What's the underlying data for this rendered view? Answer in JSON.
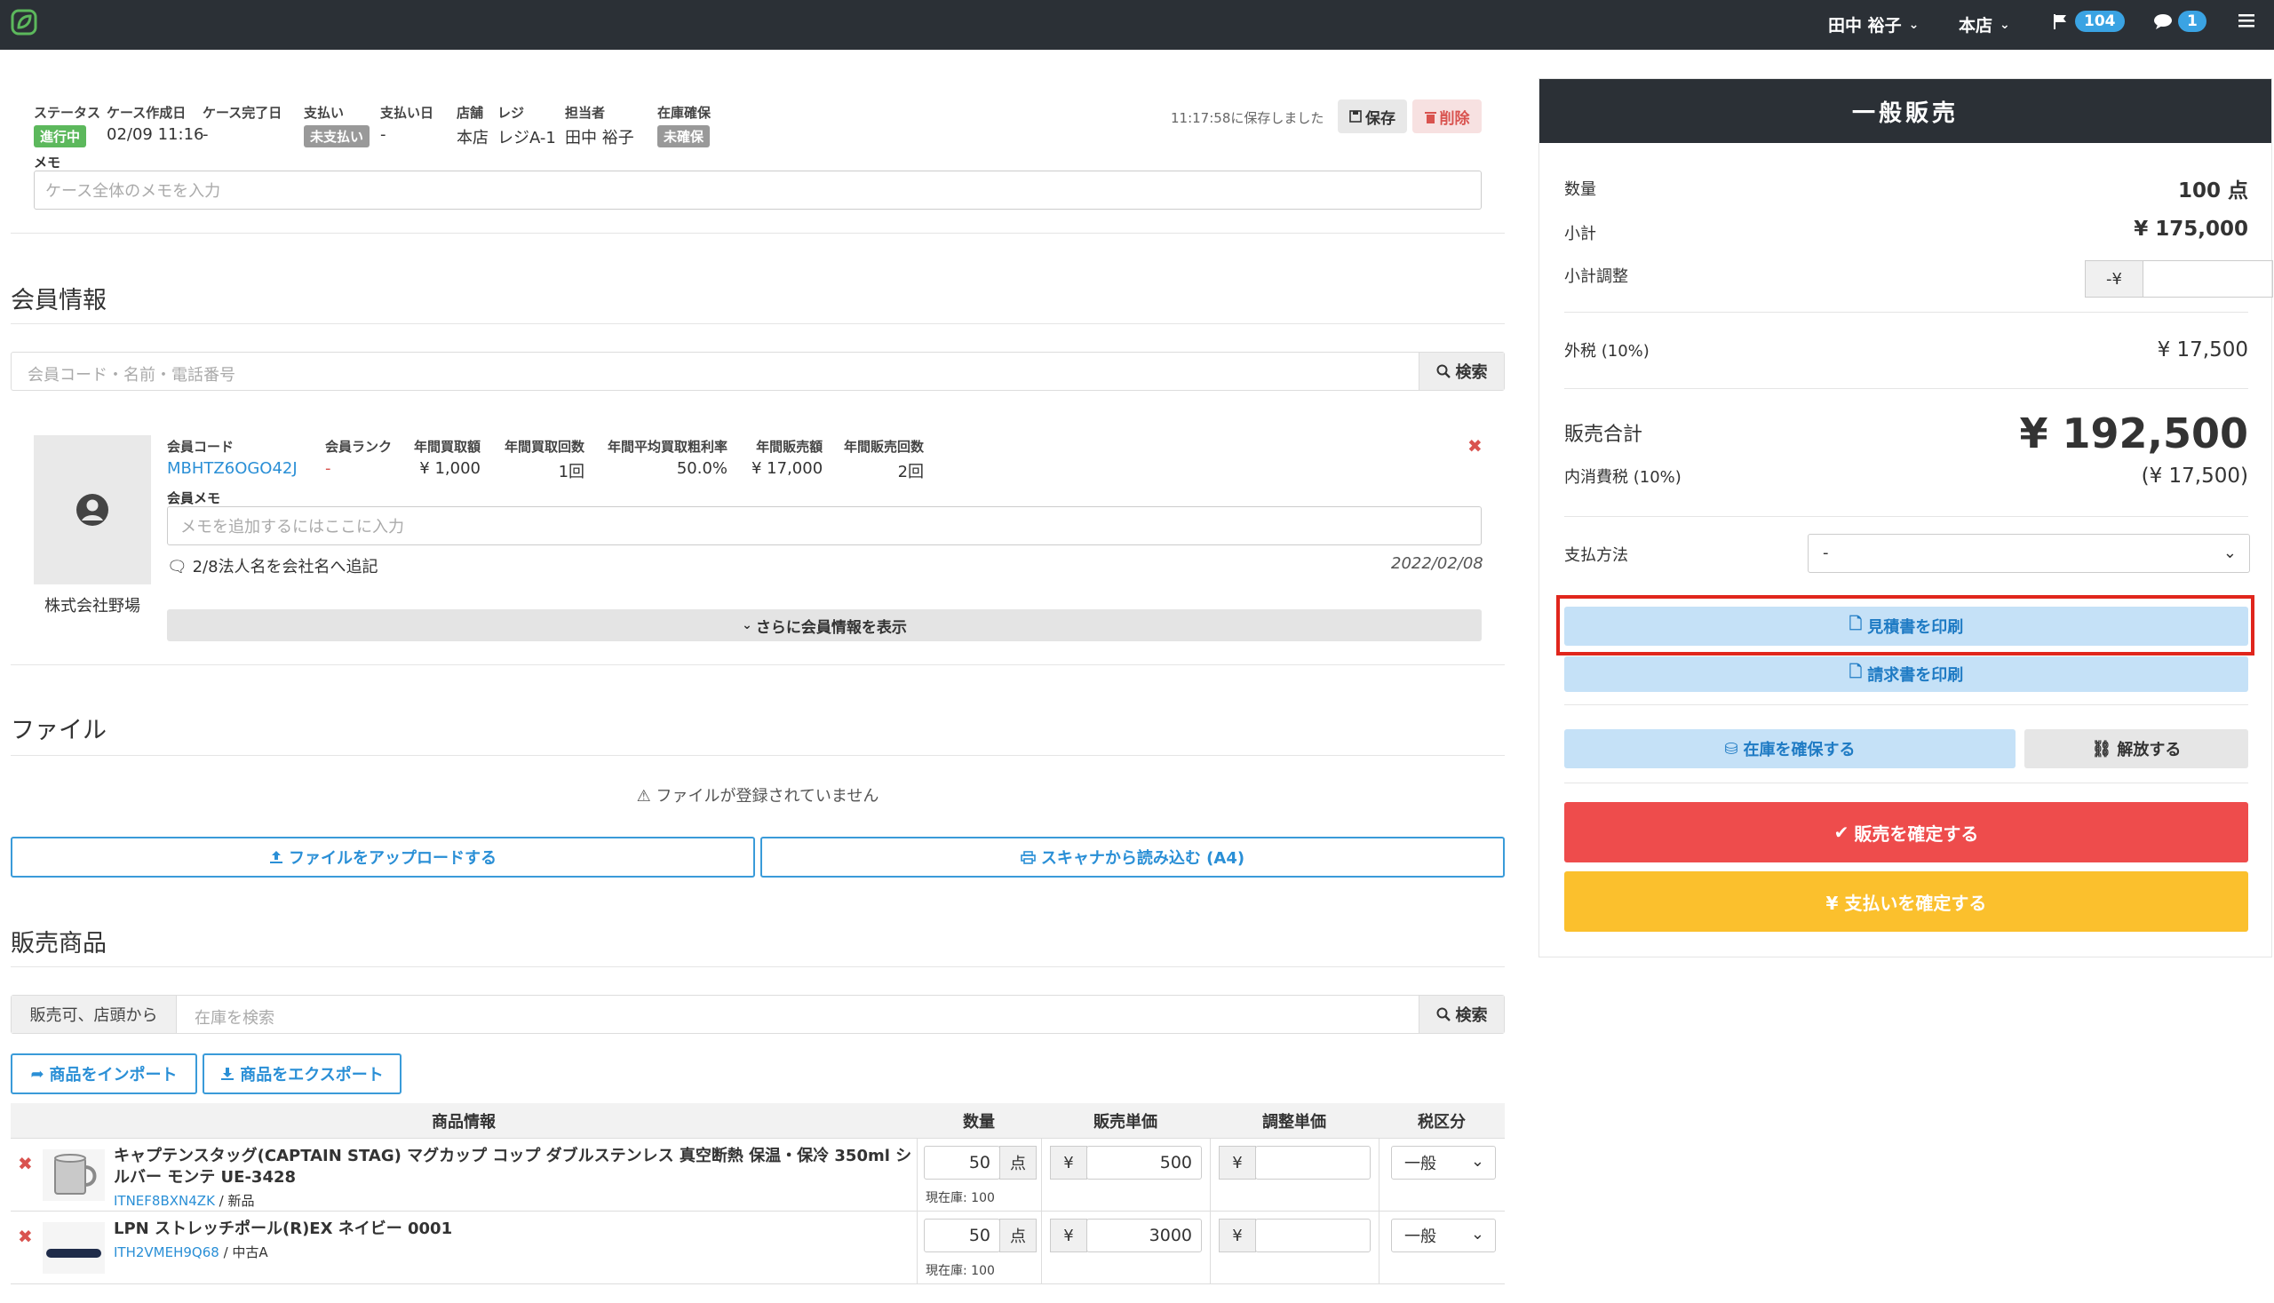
{
  "topbar": {
    "user_name": "田中 裕子",
    "store": "本店",
    "flag_count": "104",
    "chat_count": "1"
  },
  "case": {
    "status": {
      "label": "ステータス",
      "value": "進行中"
    },
    "created": {
      "label": "ケース作成日",
      "value": "02/09 11:16"
    },
    "completed": {
      "label": "ケース完了日",
      "value": "-"
    },
    "payment": {
      "label": "支払い",
      "value": "未支払い"
    },
    "payment_date": {
      "label": "支払い日",
      "value": "-"
    },
    "store": {
      "label": "店舗",
      "value": "本店"
    },
    "register": {
      "label": "レジ",
      "value": "レジA-1"
    },
    "staff": {
      "label": "担当者",
      "value": "田中 裕子"
    },
    "stock": {
      "label": "在庫確保",
      "value": "未確保"
    },
    "saved_note": "11:17:58に保存しました",
    "save_label": "保存",
    "delete_label": "削除",
    "memo_label": "メモ",
    "memo_placeholder": "ケース全体のメモを入力"
  },
  "member": {
    "section_title": "会員情報",
    "search_placeholder": "会員コード・名前・電話番号",
    "search_label": "検索",
    "name": "株式会社野場",
    "fields": {
      "code": {
        "label": "会員コード",
        "value": "MBHTZ6OGO42J"
      },
      "rank": {
        "label": "会員ランク",
        "value": "-"
      },
      "annual_buy_amount": {
        "label": "年間買取額",
        "value": "¥ 1,000"
      },
      "annual_buy_count": {
        "label": "年間買取回数",
        "value": "1回"
      },
      "annual_margin": {
        "label": "年間平均買取粗利率",
        "value": "50.0%"
      },
      "annual_sales_amount": {
        "label": "年間販売額",
        "value": "¥ 17,000"
      },
      "annual_sales_count": {
        "label": "年間販売回数",
        "value": "2回"
      }
    },
    "memo_label": "会員メモ",
    "memo_placeholder": "メモを追加するにはここに入力",
    "note": "2/8法人名を会社名へ追記",
    "note_date": "2022/02/08",
    "more_label": "さらに会員情報を表示"
  },
  "files": {
    "section_title": "ファイル",
    "empty_message": "ファイルが登録されていません",
    "upload_label": "ファイルをアップロードする",
    "scan_label": "スキャナから読み込む (A4)"
  },
  "products": {
    "section_title": "販売商品",
    "filter_label": "販売可、店頭から",
    "search_placeholder": "在庫を検索",
    "search_label": "検索",
    "import_label": "商品をインポート",
    "export_label": "商品をエクスポート",
    "columns": [
      "商品情報",
      "数量",
      "販売単価",
      "調整単価",
      "税区分"
    ],
    "unit": "点",
    "yen": "¥",
    "rows": [
      {
        "name": "キャプテンスタッグ(CAPTAIN STAG) マグカップ コップ ダブルステンレス 真空断熱 保温・保冷 350ml シルバー モンテ UE-3428",
        "code": "ITNEF8BXN4ZK",
        "condition": " / 新品",
        "qty": "50",
        "stock": "現在庫: 100",
        "price": "500",
        "tax": "一般"
      },
      {
        "name": "LPN ストレッチポール(R)EX ネイビー 0001",
        "code": "ITH2VMEH9Q68",
        "condition": " / 中古A",
        "qty": "50",
        "stock": "現在庫: 100",
        "price": "3000",
        "tax": "一般"
      }
    ]
  },
  "summary": {
    "title": "一般販売",
    "qty_label": "数量",
    "qty_value": "100 点",
    "subtotal_label": "小計",
    "subtotal_value": "¥ 175,000",
    "adjust_label": "小計調整",
    "adjust_prefix": "-¥",
    "tax_label": "外税 (10%)",
    "tax_value": "¥ 17,500",
    "total_label": "販売合計",
    "total_value": "¥ 192,500",
    "inner_tax_label": "内消費税 (10%)",
    "inner_tax_value": "(¥ 17,500)",
    "payment_label": "支払方法",
    "payment_value": "-",
    "print_estimate": "見積書を印刷",
    "print_invoice": "請求書を印刷",
    "reserve_stock": "在庫を確保する",
    "release": "解放する",
    "confirm_sale": "販売を確定する",
    "confirm_payment": "¥ 支払いを確定する"
  }
}
